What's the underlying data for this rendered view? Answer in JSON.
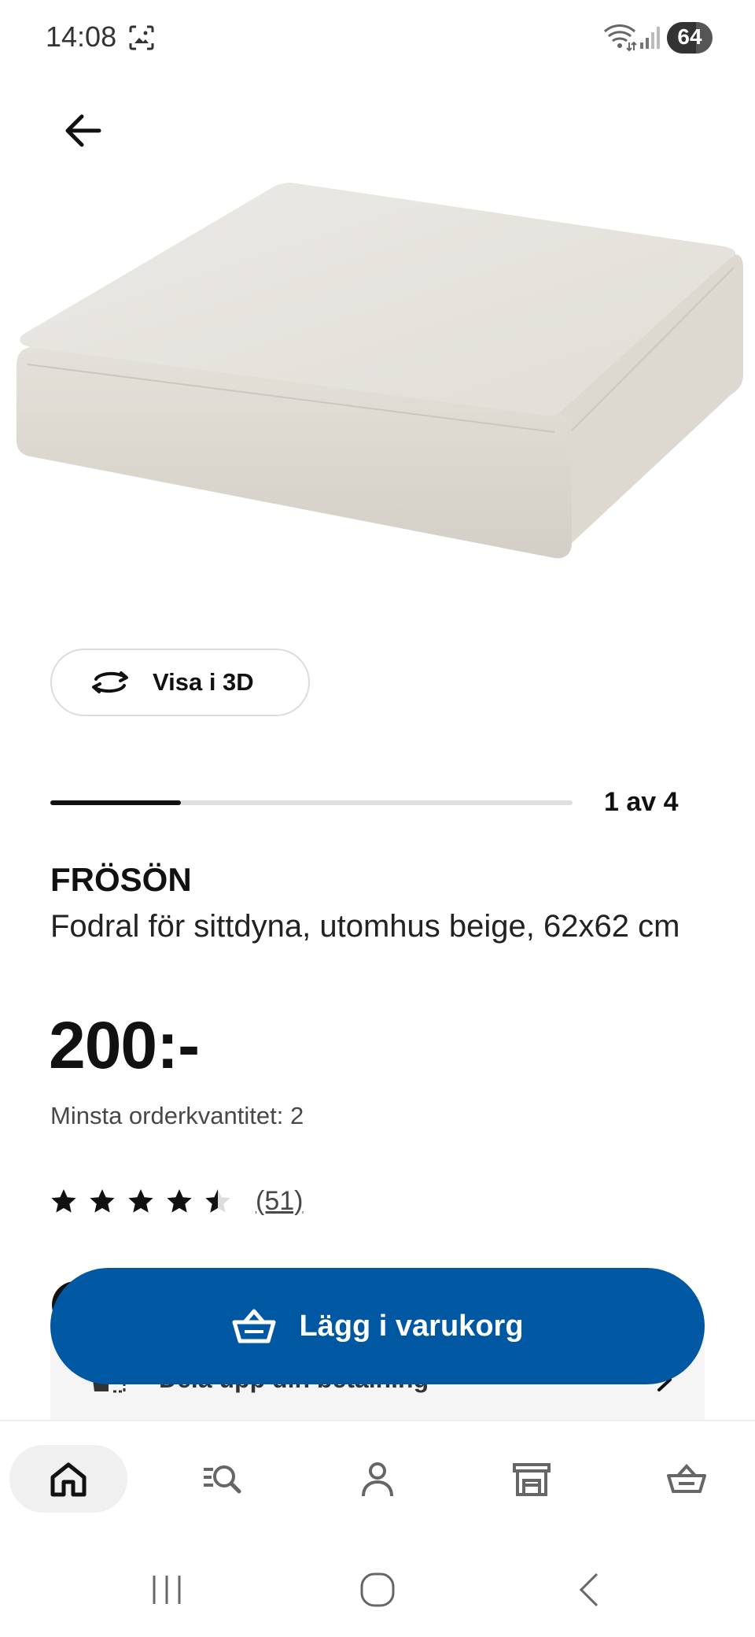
{
  "status_bar": {
    "time": "14:08",
    "battery_level": "64",
    "battery_fraction": 0.64
  },
  "navigation": {
    "back_icon": "arrow-left-icon"
  },
  "product_image": {
    "alt": "FRÖSÖN",
    "cushion_color": "#e9e7e1"
  },
  "view_3d": {
    "label": "Visa i 3D",
    "icon": "rotate-icon"
  },
  "carousel": {
    "counter": "1 av 4",
    "current": 1,
    "total": 4
  },
  "product": {
    "name": "FRÖSÖN",
    "description": "Fodral för sittdyna, utomhus beige, 62x62 cm",
    "price": "200:-",
    "min_order": "Minsta orderkvantitet: 2"
  },
  "rating": {
    "stars": 4.5,
    "max": 5,
    "reviews": "(51)"
  },
  "split_payment": {
    "label": "Dela upp din betalning"
  },
  "add_to_cart": {
    "label": "Lägg i varukorg"
  },
  "bottom_nav": {
    "items": [
      "home-icon",
      "search-list-icon",
      "profile-icon",
      "store-icon",
      "basket-icon"
    ],
    "active": "home-icon"
  },
  "colors": {
    "primary_blue": "#0058a3",
    "text_dark": "#111111",
    "muted": "#484848",
    "nav_active_bg": "#f0f0f0"
  }
}
